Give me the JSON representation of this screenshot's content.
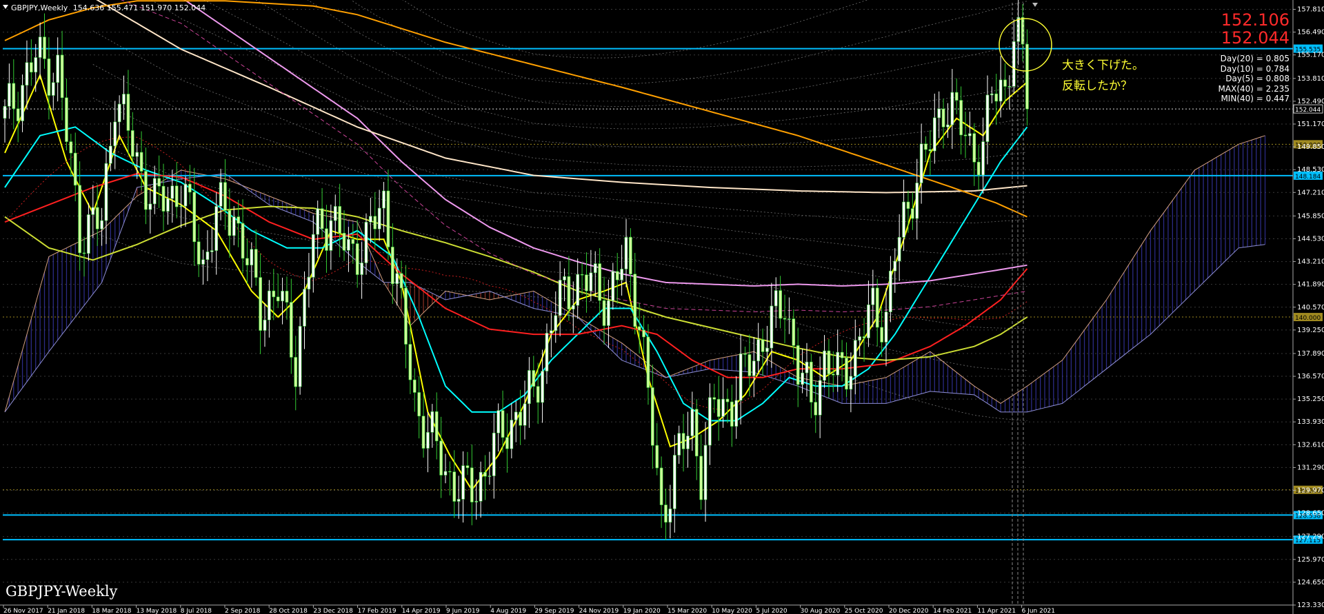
{
  "header": {
    "symbol": "GBPJPY,Weekly",
    "ohlc": "154.636 155.471 151.970 152.044"
  },
  "bottom_title": "GBPJPY-Weekly",
  "big_prices": [
    "152.106",
    "152.044"
  ],
  "stats": [
    "Day(20) = 0.805",
    "Day(10) = 0.784",
    "Day(5) = 0.808",
    "MAX(40) = 2.235",
    "MIN(40) = 0.447"
  ],
  "annotations": [
    "大きく下げた。",
    "反転したか？"
  ],
  "colors": {
    "background": "#000000",
    "candle_up": "#ffffff",
    "candle_down": "#33cc33",
    "level_lines": "#00bfff",
    "price_text": "#ff2a2a",
    "annotation": "#ffff33",
    "ma5": "#ffff00",
    "ma13": "#00ffff",
    "ma26": "#ff2020",
    "ma52": "#ccdd33",
    "ma100": "#ee99ee",
    "ma200": "#ffe6c8",
    "ma300": "#ffa000"
  },
  "chart_data": {
    "type": "candlestick",
    "symbol": "GBPJPY",
    "timeframe": "Weekly",
    "ylim": [
      123.33,
      158.19
    ],
    "y_ticks": [
      157.81,
      156.49,
      155.17,
      153.81,
      152.49,
      151.17,
      149.85,
      148.53,
      147.21,
      145.85,
      144.53,
      143.21,
      141.89,
      140.57,
      139.25,
      137.89,
      136.57,
      135.25,
      133.93,
      132.61,
      131.29,
      129.97,
      128.65,
      127.29,
      125.97,
      124.65,
      123.33
    ],
    "x_tick_labels": [
      "26 Nov 2017",
      "21 Jan 2018",
      "18 Mar 2018",
      "13 May 2018",
      "8 Jul 2018",
      "2 Sep 2018",
      "28 Oct 2018",
      "23 Dec 2018",
      "17 Feb 2019",
      "14 Apr 2019",
      "9 Jun 2019",
      "4 Aug 2019",
      "29 Sep 2019",
      "24 Nov 2019",
      "19 Jan 2020",
      "15 Mar 2020",
      "10 May 2020",
      "5 Jul 2020",
      "30 Aug 2020",
      "25 Oct 2020",
      "20 Dec 2020",
      "14 Feb 2021",
      "11 Apr 2021",
      "6 Jun 2021"
    ],
    "horizontal_levels": [
      {
        "value": 155.535,
        "label": "155.535",
        "color": "#00bfff"
      },
      {
        "value": 148.184,
        "label": "148.184",
        "color": "#00bfff"
      },
      {
        "value": 128.538,
        "label": "128.538",
        "color": "#00bfff"
      },
      {
        "value": 127.115,
        "label": "127.115",
        "color": "#00bfff"
      },
      {
        "value": 150.0,
        "label": "150.000",
        "color": "#a08a20"
      },
      {
        "value": 140.0,
        "label": "140.000",
        "color": "#a08a20"
      },
      {
        "value": 130.0,
        "label": "130.000",
        "color": "#a08a20"
      },
      {
        "value": 152.044,
        "label": "152.044",
        "color": "#dddddd"
      }
    ],
    "price_path": [
      [
        0,
        151.5
      ],
      [
        7,
        155
      ],
      [
        12,
        154.2
      ],
      [
        17,
        145
      ],
      [
        22,
        145.5
      ],
      [
        25,
        153
      ],
      [
        30,
        149
      ],
      [
        34,
        146.5
      ],
      [
        40,
        147.5
      ],
      [
        45,
        143
      ],
      [
        48,
        146
      ],
      [
        52,
        146
      ],
      [
        58,
        140.5
      ],
      [
        62,
        141.5
      ],
      [
        66,
        137.5
      ],
      [
        70,
        144.5
      ],
      [
        74,
        146
      ],
      [
        78,
        143.5
      ],
      [
        82,
        144.5
      ],
      [
        86,
        146.5
      ],
      [
        89,
        142
      ],
      [
        93,
        135
      ],
      [
        96,
        133.5
      ],
      [
        100,
        131
      ],
      [
        104,
        130
      ],
      [
        107,
        130
      ],
      [
        111,
        132.5
      ],
      [
        115,
        134
      ],
      [
        120,
        135.5
      ],
      [
        125,
        140.5
      ],
      [
        129,
        142
      ],
      [
        133,
        142
      ],
      [
        137,
        141
      ],
      [
        141,
        143.5
      ],
      [
        144,
        140
      ],
      [
        147,
        133
      ],
      [
        149,
        128.5
      ],
      [
        153,
        132
      ],
      [
        156,
        134
      ],
      [
        158,
        131
      ],
      [
        161,
        135
      ],
      [
        165,
        135
      ],
      [
        169,
        137.5
      ],
      [
        174,
        139.5
      ],
      [
        177,
        141
      ],
      [
        180,
        137
      ],
      [
        183,
        135
      ],
      [
        186,
        137.5
      ],
      [
        189,
        136.5
      ],
      [
        193,
        138
      ],
      [
        197,
        140.5
      ],
      [
        200,
        140
      ],
      [
        202,
        143.5
      ],
      [
        206,
        147.5
      ],
      [
        210,
        150
      ],
      [
        213,
        152.5
      ],
      [
        216,
        151.5
      ],
      [
        219,
        150
      ],
      [
        222,
        149.5
      ],
      [
        224,
        153
      ],
      [
        227,
        153.5
      ],
      [
        229,
        156
      ],
      [
        231,
        155.2
      ],
      [
        232,
        152.04
      ]
    ],
    "moving_averages": [
      {
        "label": "MA5",
        "color": "#ffff00",
        "points": [
          [
            0,
            149.5
          ],
          [
            8,
            154
          ],
          [
            14,
            149
          ],
          [
            20,
            146
          ],
          [
            26,
            150.5
          ],
          [
            32,
            147.5
          ],
          [
            40,
            146.5
          ],
          [
            48,
            145
          ],
          [
            56,
            141.5
          ],
          [
            62,
            140
          ],
          [
            68,
            141.5
          ],
          [
            74,
            145
          ],
          [
            80,
            144.5
          ],
          [
            86,
            144.5
          ],
          [
            90,
            142
          ],
          [
            96,
            134.5
          ],
          [
            101,
            132
          ],
          [
            106,
            130
          ],
          [
            112,
            132
          ],
          [
            118,
            135
          ],
          [
            124,
            139
          ],
          [
            130,
            141
          ],
          [
            136,
            141.5
          ],
          [
            141,
            142
          ],
          [
            146,
            136.5
          ],
          [
            151,
            132.5
          ],
          [
            156,
            133
          ],
          [
            162,
            134
          ],
          [
            168,
            135.5
          ],
          [
            174,
            138
          ],
          [
            180,
            137.5
          ],
          [
            186,
            136.5
          ],
          [
            192,
            137.5
          ],
          [
            198,
            140
          ],
          [
            204,
            144.5
          ],
          [
            210,
            149.5
          ],
          [
            216,
            151.5
          ],
          [
            222,
            150.5
          ],
          [
            227,
            152.5
          ],
          [
            232,
            153.6
          ]
        ]
      },
      {
        "label": "MA13",
        "color": "#00ffff",
        "points": [
          [
            0,
            147.5
          ],
          [
            8,
            150.5
          ],
          [
            16,
            151
          ],
          [
            24,
            149.5
          ],
          [
            32,
            148.5
          ],
          [
            40,
            147.8
          ],
          [
            48,
            146.5
          ],
          [
            56,
            145
          ],
          [
            64,
            144
          ],
          [
            72,
            144
          ],
          [
            80,
            145
          ],
          [
            88,
            143.5
          ],
          [
            94,
            140
          ],
          [
            100,
            136
          ],
          [
            106,
            134.5
          ],
          [
            112,
            134.5
          ],
          [
            118,
            135.5
          ],
          [
            124,
            137.5
          ],
          [
            130,
            139
          ],
          [
            136,
            140.5
          ],
          [
            142,
            140.5
          ],
          [
            148,
            138
          ],
          [
            154,
            135
          ],
          [
            160,
            134
          ],
          [
            166,
            134
          ],
          [
            172,
            135
          ],
          [
            178,
            136.5
          ],
          [
            184,
            136
          ],
          [
            190,
            136
          ],
          [
            196,
            137
          ],
          [
            202,
            139
          ],
          [
            208,
            141.5
          ],
          [
            214,
            144
          ],
          [
            220,
            146.5
          ],
          [
            226,
            149
          ],
          [
            232,
            151
          ]
        ]
      },
      {
        "label": "MA26",
        "color": "#ff2020",
        "points": [
          [
            0,
            145.5
          ],
          [
            10,
            146.5
          ],
          [
            20,
            147.5
          ],
          [
            30,
            148.3
          ],
          [
            40,
            148.1
          ],
          [
            50,
            147
          ],
          [
            60,
            145.5
          ],
          [
            70,
            144.5
          ],
          [
            80,
            144.8
          ],
          [
            90,
            142.5
          ],
          [
            100,
            140.5
          ],
          [
            110,
            139.3
          ],
          [
            120,
            139
          ],
          [
            130,
            139
          ],
          [
            140,
            139.5
          ],
          [
            148,
            139
          ],
          [
            156,
            137.5
          ],
          [
            164,
            136.5
          ],
          [
            172,
            136.5
          ],
          [
            180,
            137
          ],
          [
            190,
            137
          ],
          [
            200,
            137.3
          ],
          [
            210,
            138.3
          ],
          [
            218,
            139.5
          ],
          [
            226,
            141
          ],
          [
            232,
            142.8
          ]
        ]
      },
      {
        "label": "MA52",
        "color": "#ccdd33",
        "points": [
          [
            0,
            145.8
          ],
          [
            10,
            144
          ],
          [
            20,
            143.3
          ],
          [
            30,
            144.2
          ],
          [
            40,
            145.3
          ],
          [
            50,
            146.2
          ],
          [
            60,
            146.4
          ],
          [
            70,
            146.3
          ],
          [
            80,
            145.8
          ],
          [
            90,
            145
          ],
          [
            100,
            144.3
          ],
          [
            110,
            143.5
          ],
          [
            120,
            142.6
          ],
          [
            130,
            141.5
          ],
          [
            140,
            140.8
          ],
          [
            150,
            140
          ],
          [
            160,
            139.4
          ],
          [
            170,
            138.8
          ],
          [
            180,
            138.2
          ],
          [
            190,
            137.7
          ],
          [
            200,
            137.5
          ],
          [
            210,
            137.7
          ],
          [
            220,
            138.3
          ],
          [
            226,
            139
          ],
          [
            232,
            140
          ]
        ]
      },
      {
        "label": "MA100",
        "color": "#ee99ee",
        "points": [
          [
            40,
            158.5
          ],
          [
            60,
            155
          ],
          [
            80,
            151.5
          ],
          [
            90,
            149
          ],
          [
            100,
            146.8
          ],
          [
            110,
            145.2
          ],
          [
            120,
            144
          ],
          [
            130,
            143.2
          ],
          [
            140,
            142.5
          ],
          [
            150,
            142
          ],
          [
            160,
            141.9
          ],
          [
            170,
            141.8
          ],
          [
            180,
            141.9
          ],
          [
            190,
            141.8
          ],
          [
            200,
            141.9
          ],
          [
            210,
            142.1
          ],
          [
            220,
            142.5
          ],
          [
            232,
            143
          ]
        ]
      },
      {
        "label": "MA200",
        "color": "#ffe6c8",
        "points": [
          [
            20,
            158.5
          ],
          [
            40,
            155.5
          ],
          [
            60,
            153.3
          ],
          [
            80,
            151
          ],
          [
            100,
            149.2
          ],
          [
            120,
            148.2
          ],
          [
            140,
            147.8
          ],
          [
            160,
            147.5
          ],
          [
            180,
            147.3
          ],
          [
            200,
            147.2
          ],
          [
            220,
            147.3
          ],
          [
            232,
            147.6
          ]
        ]
      },
      {
        "label": "MA300",
        "color": "#ffa000",
        "points": [
          [
            0,
            156
          ],
          [
            10,
            157.2
          ],
          [
            20,
            157.9
          ],
          [
            30,
            158.3
          ],
          [
            50,
            158.3
          ],
          [
            70,
            158
          ],
          [
            80,
            157.5
          ],
          [
            90,
            156.7
          ],
          [
            100,
            155.9
          ],
          [
            120,
            154.6
          ],
          [
            140,
            153.3
          ],
          [
            160,
            151.9
          ],
          [
            180,
            150.5
          ],
          [
            200,
            148.8
          ],
          [
            215,
            147.5
          ],
          [
            225,
            146.6
          ],
          [
            232,
            145.8
          ]
        ]
      }
    ],
    "ichimoku_cloud": {
      "span_a": [
        [
          0,
          134.5
        ],
        [
          10,
          143.5
        ],
        [
          22,
          145
        ],
        [
          30,
          147
        ],
        [
          40,
          148.5
        ],
        [
          50,
          148
        ],
        [
          60,
          147
        ],
        [
          70,
          146
        ],
        [
          80,
          145.5
        ],
        [
          86,
          142
        ],
        [
          92,
          139.5
        ],
        [
          100,
          141.5
        ],
        [
          110,
          141
        ],
        [
          120,
          141.5
        ],
        [
          130,
          140
        ],
        [
          140,
          138.5
        ],
        [
          150,
          136.5
        ],
        [
          160,
          137.5
        ],
        [
          170,
          138
        ],
        [
          180,
          136.5
        ],
        [
          190,
          136
        ],
        [
          200,
          136.5
        ],
        [
          210,
          138
        ],
        [
          220,
          136
        ],
        [
          226,
          135
        ],
        [
          232,
          136
        ],
        [
          240,
          137.5
        ],
        [
          250,
          141
        ],
        [
          260,
          145
        ],
        [
          270,
          148.5
        ],
        [
          280,
          150
        ],
        [
          286,
          150.5
        ]
      ],
      "span_b": [
        [
          0,
          134.5
        ],
        [
          10,
          138
        ],
        [
          22,
          142
        ],
        [
          30,
          147.5
        ],
        [
          40,
          148
        ],
        [
          50,
          148.3
        ],
        [
          60,
          146.5
        ],
        [
          70,
          145.5
        ],
        [
          80,
          143.2
        ],
        [
          86,
          142
        ],
        [
          92,
          142
        ],
        [
          100,
          141
        ],
        [
          110,
          141.5
        ],
        [
          120,
          140.5
        ],
        [
          130,
          140
        ],
        [
          140,
          137.5
        ],
        [
          150,
          136.5
        ],
        [
          160,
          137
        ],
        [
          170,
          136.8
        ],
        [
          180,
          136
        ],
        [
          190,
          135
        ],
        [
          200,
          135
        ],
        [
          210,
          135.7
        ],
        [
          220,
          135.5
        ],
        [
          226,
          134.5
        ],
        [
          232,
          134.5
        ],
        [
          240,
          135
        ],
        [
          250,
          137
        ],
        [
          260,
          139
        ],
        [
          270,
          141.5
        ],
        [
          280,
          144
        ],
        [
          286,
          144.2
        ]
      ]
    },
    "annotations": [
      "大きく下げた。",
      "反転したか？"
    ]
  }
}
